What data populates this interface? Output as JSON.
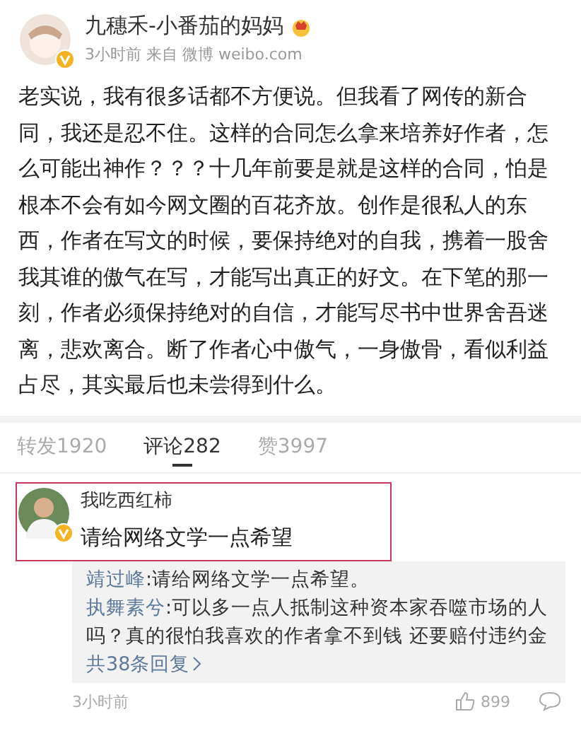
{
  "post": {
    "author": "九穗禾-小番茄的妈妈",
    "verified": true,
    "meta": "3小时前 来自 微博 weibo.com",
    "text": "老实说，我有很多话都不方便说。但我看了网传的新合同，我还是忍不住。这样的合同怎么拿来培养好作者，怎么可能出神作？？？十几年前要是就是这样的合同，怕是根本不会有如今网文圈的百花齐放。创作是很私人的东西，作者在写文的时候，要保持绝对的自我，携着一股舍我其谁的傲气在写，才能写出真正的好文。在下笔的那一刻，作者必须保持绝对的自信，才能写尽书中世界舍吾迷离，悲欢离合。断了作者心中傲气，一身傲骨，看似利益占尽，其实最后也未尝得到什么。"
  },
  "tabs": [
    {
      "label": "转发1920",
      "selected": false
    },
    {
      "label": "评论282",
      "selected": true
    },
    {
      "label": "赞3997",
      "selected": false
    }
  ],
  "comment": {
    "author": "我吃西红柿",
    "verified": true,
    "highlighted": true,
    "text": "请给网络文学一点希望",
    "replies": [
      {
        "name": "靖过峰",
        "text": ":请给网络文学一点希望。"
      },
      {
        "name": "执舞素兮",
        "text": ":可以多一点人抵制这种资本家吞噬市场的人吗？真的很怕我喜欢的作者拿不到钱 还要赔付违约金"
      }
    ],
    "more": "共38条回复",
    "time": "3小时前",
    "likes": "899"
  }
}
